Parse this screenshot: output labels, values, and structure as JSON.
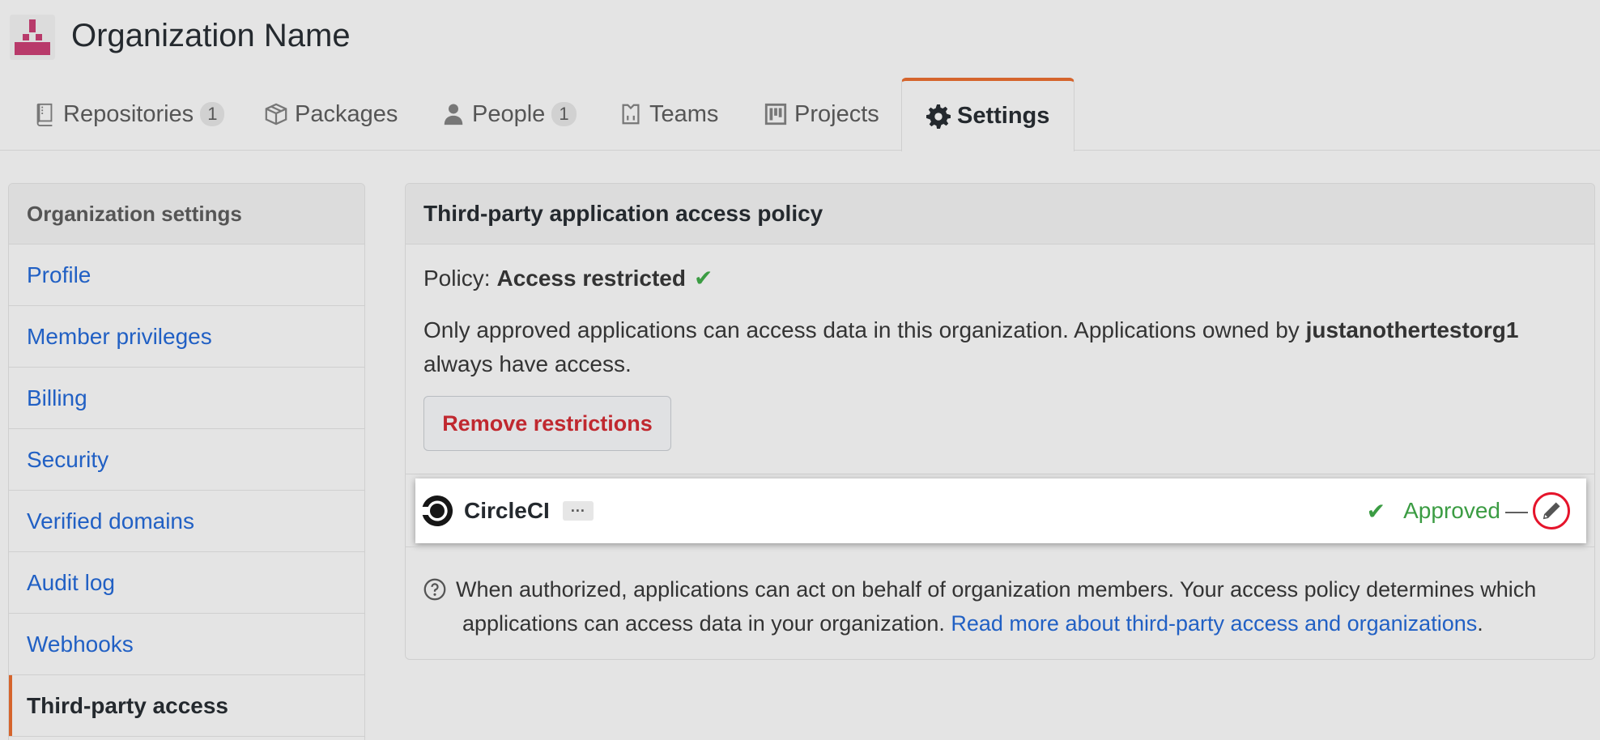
{
  "org": {
    "name": "Organization Name",
    "avatar_icon": "org-avatar-icon"
  },
  "tabs": [
    {
      "label": "Repositories",
      "count": "1",
      "icon": "repo-icon"
    },
    {
      "label": "Packages",
      "icon": "package-icon"
    },
    {
      "label": "People",
      "count": "1",
      "icon": "person-icon"
    },
    {
      "label": "Teams",
      "icon": "team-icon"
    },
    {
      "label": "Projects",
      "icon": "project-icon"
    },
    {
      "label": "Settings",
      "icon": "gear-icon",
      "active": true
    }
  ],
  "sidebar": {
    "heading": "Organization settings",
    "items": [
      {
        "label": "Profile"
      },
      {
        "label": "Member privileges"
      },
      {
        "label": "Billing"
      },
      {
        "label": "Security"
      },
      {
        "label": "Verified domains"
      },
      {
        "label": "Audit log"
      },
      {
        "label": "Webhooks"
      },
      {
        "label": "Third-party access",
        "active": true
      }
    ]
  },
  "panel": {
    "title": "Third-party application access policy",
    "policy_prefix": "Policy:",
    "policy_value": "Access restricted",
    "desc_part1": "Only approved applications can access data in this organization. Applications owned by ",
    "desc_owner": "justanothertestorg1",
    "desc_part2": " always have access.",
    "remove_button": "Remove restrictions",
    "app": {
      "name": "CircleCI",
      "more": "···",
      "status": "Approved",
      "dash": "—"
    },
    "help_part1": "When authorized, applications can act on behalf of organization members. Your access policy determines which",
    "help_part2": "applications can access data in your organization. ",
    "help_link": "Read more about third-party access and organizations",
    "help_end": "."
  },
  "colors": {
    "accent": "#d5642c",
    "link": "#2160c4",
    "danger": "#c0282f",
    "success": "#3b9c43",
    "highlight_ring": "#e5142b"
  }
}
